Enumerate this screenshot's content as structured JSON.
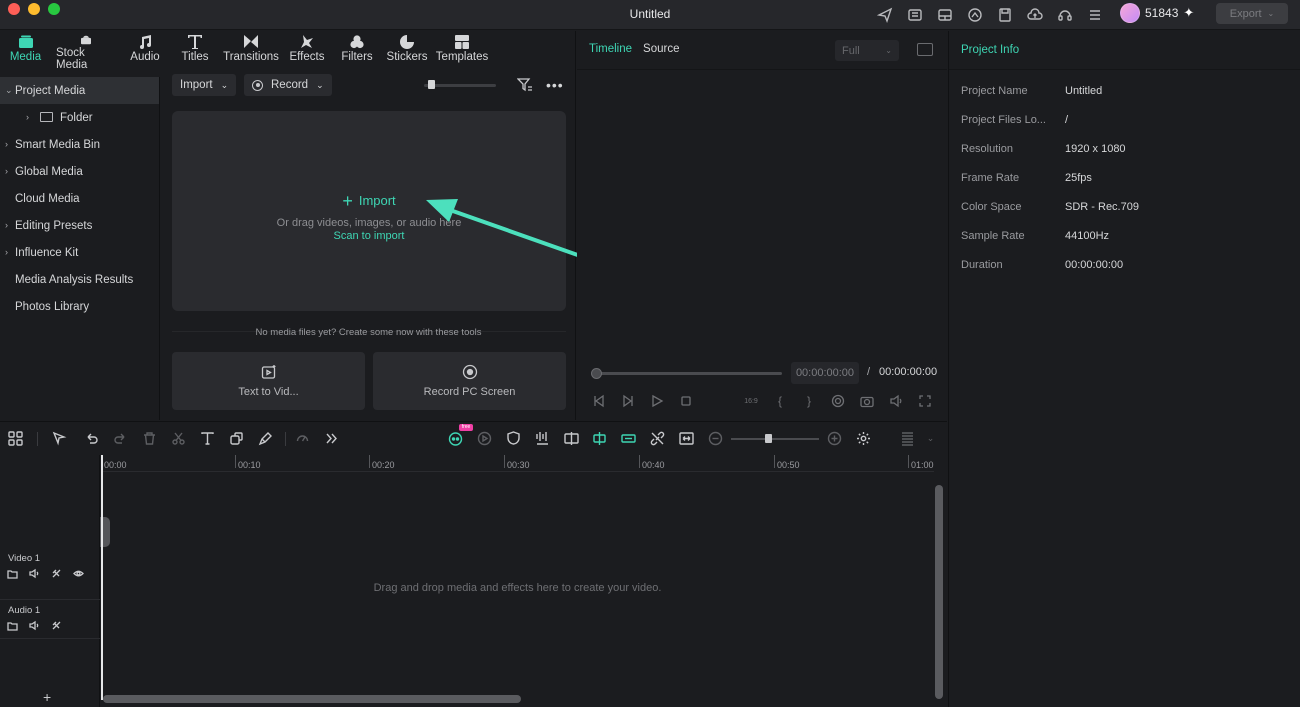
{
  "window": {
    "title": "Untitled",
    "credits": "51843",
    "export_label": "Export"
  },
  "tabs": [
    {
      "label": "Media",
      "icon": "media-icon",
      "active": true
    },
    {
      "label": "Stock Media",
      "icon": "stock-media-icon"
    },
    {
      "label": "Audio",
      "icon": "music-note-icon"
    },
    {
      "label": "Titles",
      "icon": "titles-icon"
    },
    {
      "label": "Transitions",
      "icon": "transitions-icon"
    },
    {
      "label": "Effects",
      "icon": "effects-icon"
    },
    {
      "label": "Filters",
      "icon": "filters-icon"
    },
    {
      "label": "Stickers",
      "icon": "stickers-icon"
    },
    {
      "label": "Templates",
      "icon": "templates-icon"
    }
  ],
  "sidebar": {
    "items": [
      {
        "label": "Project Media",
        "expanded": true
      },
      {
        "label": "Folder"
      },
      {
        "label": "Smart Media Bin"
      },
      {
        "label": "Global Media"
      },
      {
        "label": "Cloud Media"
      },
      {
        "label": "Editing Presets"
      },
      {
        "label": "Influence Kit"
      },
      {
        "label": "Media Analysis Results"
      },
      {
        "label": "Photos Library"
      }
    ]
  },
  "media": {
    "import_label": "Import",
    "record_label": "Record",
    "drop_import": "Import",
    "drop_hint": "Or drag videos, images, or audio here",
    "scan_label": "Scan to import",
    "no_media": "No media files yet? Create some now with these tools",
    "tool_text_to_video": "Text to Vid...",
    "tool_record_screen": "Record PC Screen"
  },
  "preview": {
    "tab_timeline": "Timeline",
    "tab_source": "Source",
    "quality": "Full",
    "current_time": "00:00:00:00",
    "separator": "/",
    "total_time": "00:00:00:00"
  },
  "project_info": {
    "title": "Project Info",
    "rows": [
      {
        "label": "Project Name",
        "value": "Untitled"
      },
      {
        "label": "Project Files Lo...",
        "value": "/"
      },
      {
        "label": "Resolution",
        "value": "1920 x 1080"
      },
      {
        "label": "Frame Rate",
        "value": "25fps"
      },
      {
        "label": "Color Space",
        "value": "SDR - Rec.709"
      },
      {
        "label": "Sample Rate",
        "value": "44100Hz"
      },
      {
        "label": "Duration",
        "value": "00:00:00:00"
      }
    ]
  },
  "timeline": {
    "ruler": [
      "00:00",
      "00:10",
      "00:20",
      "00:30",
      "00:40",
      "00:50",
      "01:00"
    ],
    "tracks": [
      {
        "name": "Video 1"
      },
      {
        "name": "Audio 1"
      }
    ],
    "hint": "Drag and drop media and effects here to create your video.",
    "badge": "free"
  },
  "colors": {
    "accent": "#3ed6b4",
    "background": "#1b1c1f",
    "panel": "#2a2b2f"
  }
}
